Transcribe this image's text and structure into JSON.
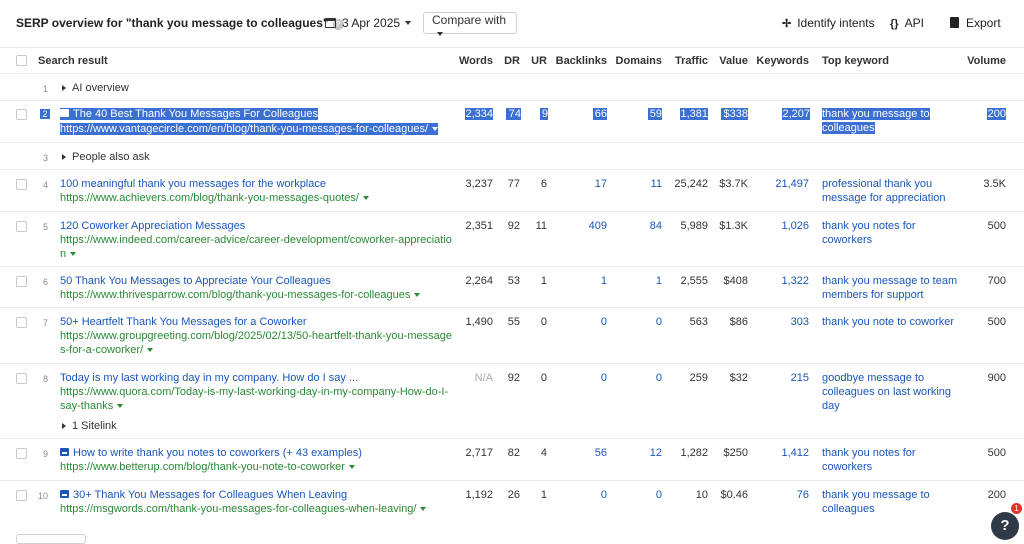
{
  "header": {
    "title": "SERP overview for \"thank you message to colleagues\"",
    "date": "3 Apr 2025",
    "compare_label": "Compare with",
    "identify_label": "Identify intents",
    "api_label": "API",
    "export_label": "Export"
  },
  "columns": {
    "search_result": "Search result",
    "words": "Words",
    "dr": "DR",
    "ur": "UR",
    "backlinks": "Backlinks",
    "domains": "Domains",
    "traffic": "Traffic",
    "value": "Value",
    "keywords": "Keywords",
    "top_keyword": "Top keyword",
    "volume": "Volume"
  },
  "features": {
    "ai_overview": {
      "num": "1",
      "label": "AI overview"
    },
    "people_also_ask": {
      "num": "3",
      "label": "People also ask"
    },
    "sitelink": {
      "label": "1 Sitelink"
    }
  },
  "rows": [
    {
      "num": "2",
      "title": "The 40 Best Thank You Messages For Colleagues",
      "url_l1": "https://www.vantagecircle.com/en/blog/thank-you-messages-for-colleagues/",
      "url_l2": "",
      "words": "2,334",
      "dr": "74",
      "ur": "9",
      "backlinks": "66",
      "domains": "59",
      "traffic": "1,381",
      "value": "$338",
      "keywords": "2,207",
      "kw_l1": "thank you message to",
      "kw_l2": "colleagues",
      "kw_l3": "",
      "volume": "200"
    },
    {
      "num": "4",
      "title": "100 meaningful thank you messages for the workplace",
      "url_l1": "https://www.achievers.com/blog/thank-you-messages-quotes/",
      "url_l2": "",
      "words": "3,237",
      "dr": "77",
      "ur": "6",
      "backlinks": "17",
      "domains": "11",
      "traffic": "25,242",
      "value": "$3.7K",
      "keywords": "21,497",
      "kw_l1": "professional thank you",
      "kw_l2": "message for appreciation",
      "kw_l3": "",
      "volume": "3.5K"
    },
    {
      "num": "5",
      "title": "120 Coworker Appreciation Messages",
      "url_l1": "https://www.indeed.com/career-advice/career-development/coworker-appreciatio",
      "url_l2": "n",
      "words": "2,351",
      "dr": "92",
      "ur": "11",
      "backlinks": "409",
      "domains": "84",
      "traffic": "5,989",
      "value": "$1.3K",
      "keywords": "1,026",
      "kw_l1": "thank you notes for",
      "kw_l2": "coworkers",
      "kw_l3": "",
      "volume": "500"
    },
    {
      "num": "6",
      "title": "50 Thank You Messages to Appreciate Your Colleagues",
      "url_l1": "https://www.thrivesparrow.com/blog/thank-you-messages-for-colleagues",
      "url_l2": "",
      "words": "2,264",
      "dr": "53",
      "ur": "1",
      "backlinks": "1",
      "domains": "1",
      "traffic": "2,555",
      "value": "$408",
      "keywords": "1,322",
      "kw_l1": "thank you message to team",
      "kw_l2": "members for support",
      "kw_l3": "",
      "volume": "700"
    },
    {
      "num": "7",
      "title": "50+ Heartfelt Thank You Messages for a Coworker",
      "url_l1": "https://www.groupgreeting.com/blog/2025/02/13/50-heartfelt-thank-you-message",
      "url_l2": "s-for-a-coworker/",
      "words": "1,490",
      "dr": "55",
      "ur": "0",
      "backlinks": "0",
      "domains": "0",
      "traffic": "563",
      "value": "$86",
      "keywords": "303",
      "kw_l1": "thank you note to coworker",
      "kw_l2": "",
      "kw_l3": "",
      "volume": "500"
    },
    {
      "num": "8",
      "title": "Today is my last working day in my company. How do I say ...",
      "url_l1": "https://www.quora.com/Today-is-my-last-working-day-in-my-company-How-do-I-",
      "url_l2": "say-thanks",
      "words": "N/A",
      "dr": "92",
      "ur": "0",
      "backlinks": "0",
      "domains": "0",
      "traffic": "259",
      "value": "$32",
      "keywords": "215",
      "kw_l1": "goodbye message to",
      "kw_l2": "colleagues on last working",
      "kw_l3": "day",
      "volume": "900"
    },
    {
      "num": "9",
      "title": "How to write thank you notes to coworkers (+ 43 examples)",
      "url_l1": "https://www.betterup.com/blog/thank-you-note-to-coworker",
      "url_l2": "",
      "words": "2,717",
      "dr": "82",
      "ur": "4",
      "backlinks": "56",
      "domains": "12",
      "traffic": "1,282",
      "value": "$250",
      "keywords": "1,412",
      "kw_l1": "thank you notes for",
      "kw_l2": "coworkers",
      "kw_l3": "",
      "volume": "500"
    },
    {
      "num": "10",
      "title": "30+ Thank You Messages for Colleagues When Leaving",
      "url_l1": "https://msgwords.com/thank-you-messages-for-colleagues-when-leaving/",
      "url_l2": "",
      "words": "1,192",
      "dr": "26",
      "ur": "1",
      "backlinks": "0",
      "domains": "0",
      "traffic": "10",
      "value": "$0.46",
      "keywords": "76",
      "kw_l1": "thank you message to",
      "kw_l2": "colleagues",
      "kw_l3": "",
      "volume": "200"
    }
  ],
  "help": {
    "icon_glyph": "?",
    "badge": "1"
  },
  "colors": {
    "link": "#1a57b9",
    "url": "#2a8a36",
    "selection": "#3b6fd1"
  }
}
